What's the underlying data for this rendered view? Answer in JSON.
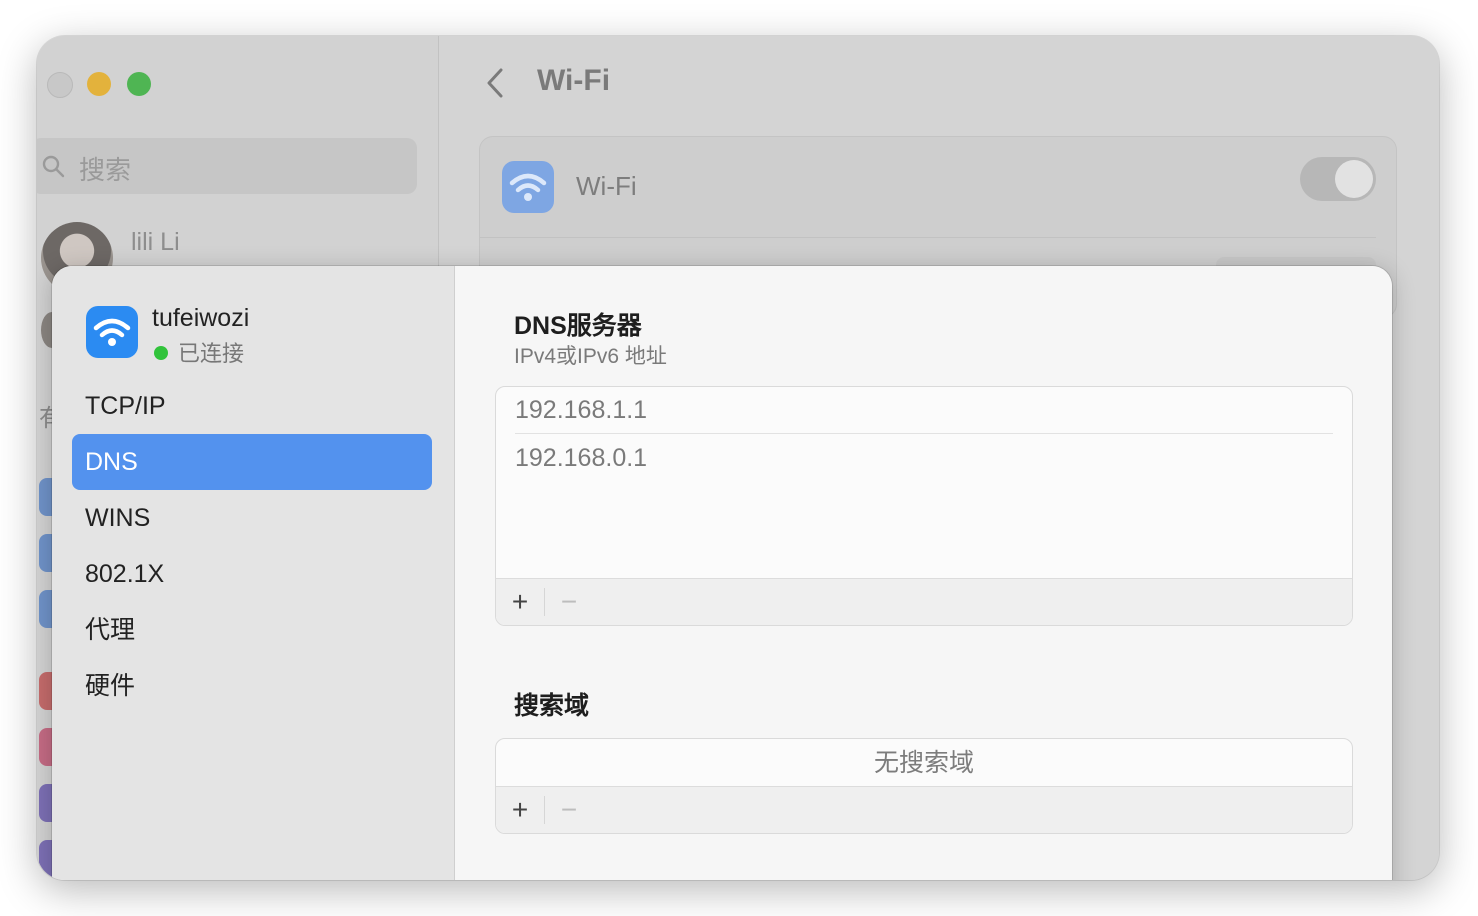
{
  "window": {
    "search_placeholder": "搜索",
    "user_name": "lili Li",
    "sidebar_fragment": "有",
    "main_title": "Wi-Fi",
    "wifi_label": "Wi-Fi",
    "wifi_toggle_on": false
  },
  "sheet": {
    "network": {
      "name": "tufeiwozi",
      "status": "已连接"
    },
    "nav": [
      {
        "label": "TCP/IP",
        "active": false
      },
      {
        "label": "DNS",
        "active": true
      },
      {
        "label": "WINS",
        "active": false
      },
      {
        "label": "802.1X",
        "active": false
      },
      {
        "label": "代理",
        "active": false
      },
      {
        "label": "硬件",
        "active": false
      }
    ],
    "dns": {
      "title": "DNS服务器",
      "subtitle": "IPv4或IPv6 地址",
      "servers": [
        "192.168.1.1",
        "192.168.0.1"
      ],
      "add_label": "+",
      "remove_label": "−"
    },
    "search_domains": {
      "title": "搜索域",
      "empty_text": "无搜索域",
      "add_label": "+",
      "remove_label": "−"
    }
  },
  "colors": {
    "accent": "#5392ee",
    "wifi_icon": "#2b8bf2",
    "status_dot": "#31c33b"
  }
}
